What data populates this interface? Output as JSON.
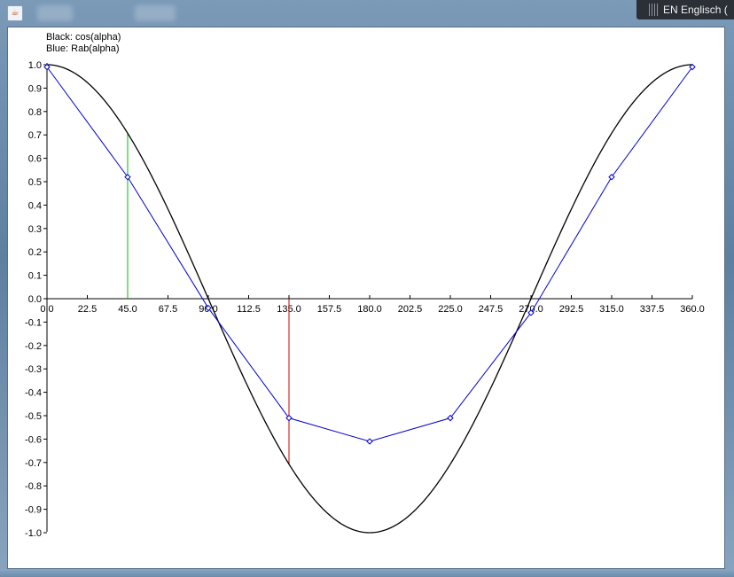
{
  "window": {
    "java_icon": "java-icon"
  },
  "taskbar": {
    "language_indicator": "EN Englisch ("
  },
  "legend": {
    "line1": "Black: cos(alpha)",
    "line2": "Blue:  Rab(alpha)"
  },
  "colors": {
    "cos_curve": "#000000",
    "rab_curve": "#0000cc",
    "green_marker": "#00bb00",
    "red_marker": "#cc0000"
  },
  "chart_data": {
    "type": "line",
    "title": "",
    "xlabel": "",
    "ylabel": "",
    "xlim": [
      0,
      360
    ],
    "ylim": [
      -1.0,
      1.0
    ],
    "x_ticks": [
      "0.0",
      "22.5",
      "45.0",
      "67.5",
      "90.0",
      "112.5",
      "135.0",
      "157.5",
      "180.0",
      "202.5",
      "225.0",
      "247.5",
      "270.0",
      "292.5",
      "315.0",
      "337.5",
      "360.0"
    ],
    "y_ticks": [
      "1.0",
      "0.9",
      "0.8",
      "0.7",
      "0.6",
      "0.5",
      "0.4",
      "0.3",
      "0.2",
      "0.1",
      "0.0",
      "-0.1",
      "-0.2",
      "-0.3",
      "-0.4",
      "-0.5",
      "-0.6",
      "-0.7",
      "-0.8",
      "-0.9",
      "-1.0"
    ],
    "series": [
      {
        "name": "cos(alpha)",
        "function": "cos",
        "color": "#000000"
      },
      {
        "name": "Rab(alpha)",
        "color": "#0000cc",
        "marker": "diamond",
        "x": [
          0,
          45,
          90,
          135,
          180,
          225,
          270,
          315,
          360
        ],
        "y": [
          0.99,
          0.52,
          -0.04,
          -0.51,
          -0.61,
          -0.51,
          -0.06,
          0.52,
          0.99
        ]
      }
    ],
    "markers": [
      {
        "x": 45,
        "y": 0.707,
        "color": "green"
      },
      {
        "x": 135,
        "y": -0.707,
        "color": "red"
      }
    ]
  }
}
